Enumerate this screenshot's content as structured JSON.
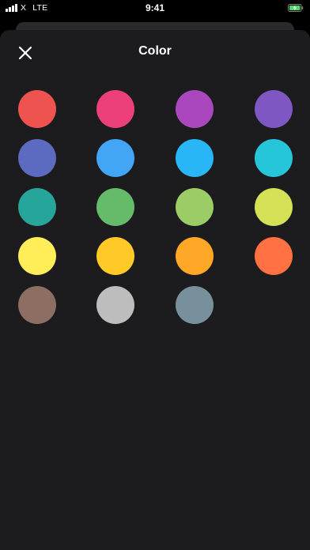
{
  "status_bar": {
    "carrier": "X",
    "network": "LTE",
    "time": "9:41",
    "battery_color": "#4cd964"
  },
  "header": {
    "title": "Color",
    "close_icon": "close-icon"
  },
  "colors": [
    {
      "name": "red",
      "hex": "#ef5350"
    },
    {
      "name": "pink",
      "hex": "#ec407a"
    },
    {
      "name": "purple",
      "hex": "#ab47bc"
    },
    {
      "name": "deep-purple",
      "hex": "#7e57c2"
    },
    {
      "name": "indigo",
      "hex": "#5c6bc0"
    },
    {
      "name": "blue",
      "hex": "#42a5f5"
    },
    {
      "name": "light-blue",
      "hex": "#29b6f6"
    },
    {
      "name": "cyan",
      "hex": "#26c6da"
    },
    {
      "name": "teal",
      "hex": "#26a69a"
    },
    {
      "name": "green",
      "hex": "#66bb6a"
    },
    {
      "name": "light-green",
      "hex": "#9ccc65"
    },
    {
      "name": "lime",
      "hex": "#d4e157"
    },
    {
      "name": "yellow",
      "hex": "#ffee58"
    },
    {
      "name": "amber",
      "hex": "#ffca28"
    },
    {
      "name": "orange",
      "hex": "#ffa726"
    },
    {
      "name": "deep-orange",
      "hex": "#ff7043"
    },
    {
      "name": "brown",
      "hex": "#8d6e63"
    },
    {
      "name": "grey",
      "hex": "#bdbdbd"
    },
    {
      "name": "blue-grey",
      "hex": "#78909c"
    }
  ]
}
